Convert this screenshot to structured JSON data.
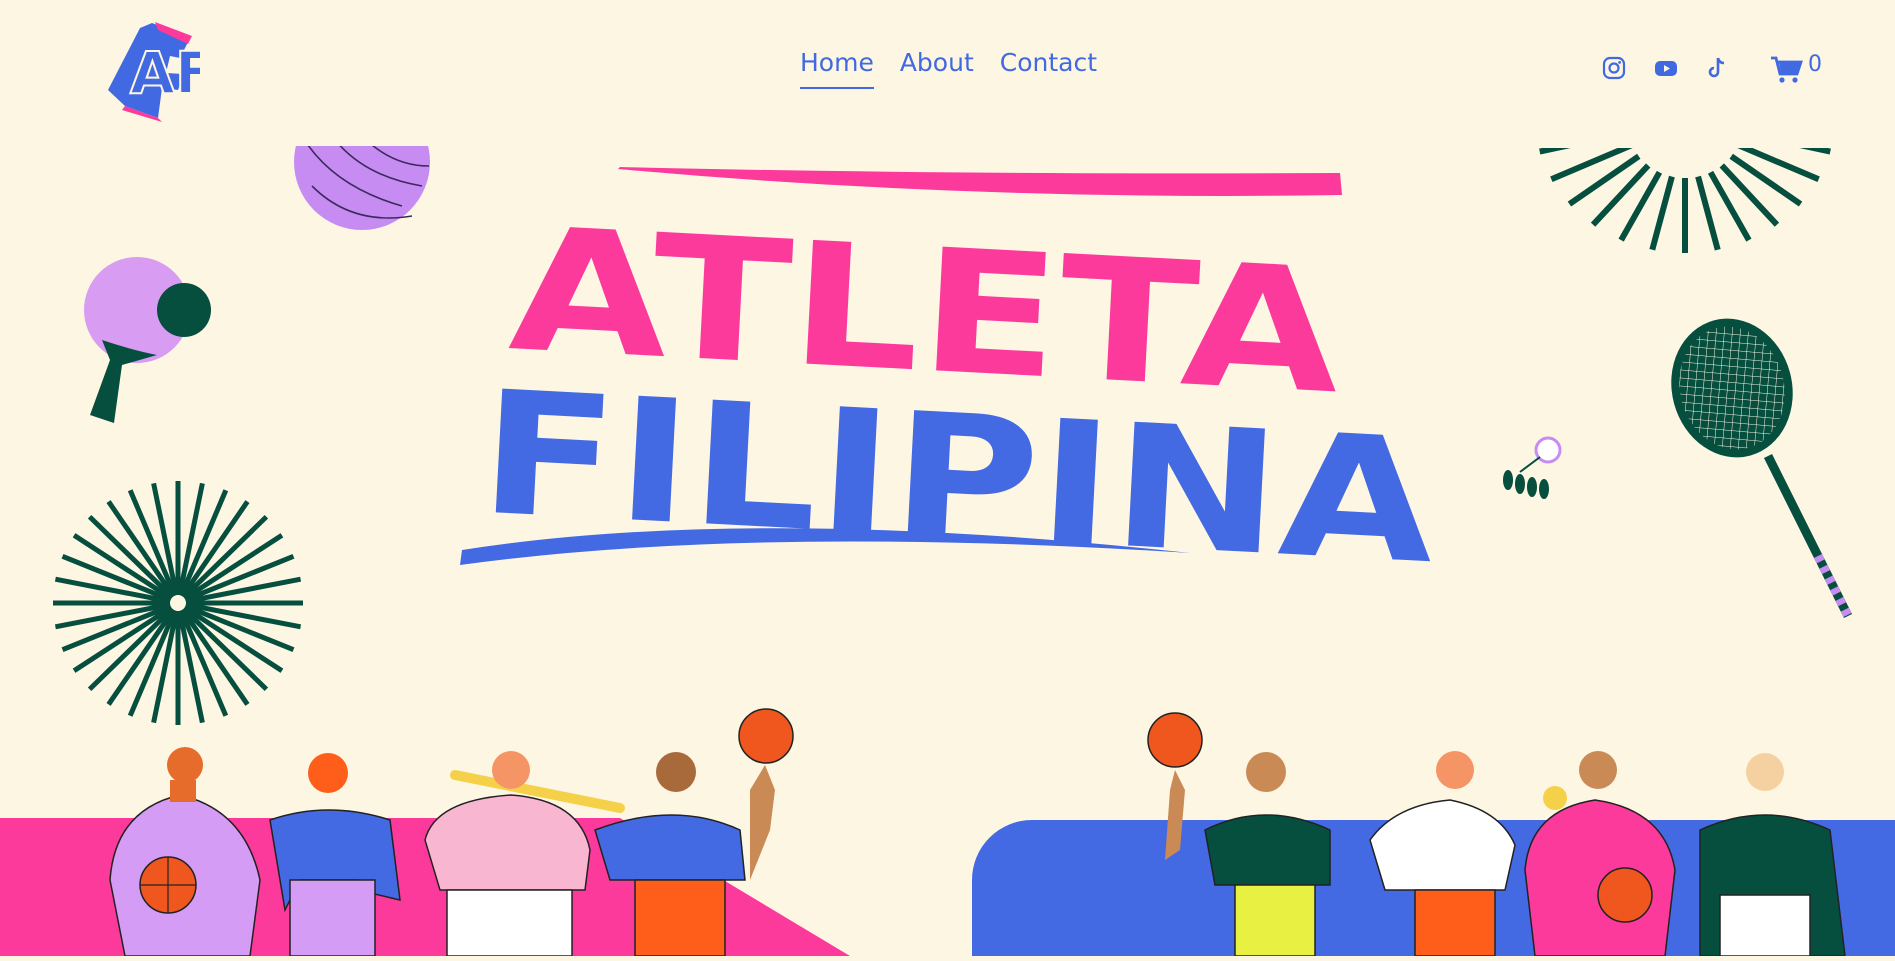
{
  "brand": {
    "logo_text": "AF",
    "colors": {
      "blue": "#4169e1",
      "pink": "#fc3a9b",
      "green": "#064f3f",
      "cream": "#fdf6e3",
      "lilac": "#d59cf5"
    }
  },
  "nav": {
    "items": [
      {
        "label": "Home",
        "active": true
      },
      {
        "label": "About",
        "active": false
      },
      {
        "label": "Contact",
        "active": false
      }
    ]
  },
  "social": {
    "icons": [
      "instagram-icon",
      "youtube-icon",
      "tiktok-icon"
    ]
  },
  "cart": {
    "icon": "cart-icon",
    "count": "0"
  },
  "hero": {
    "line1": "ATLETA",
    "line2": "FILIPINA"
  },
  "decorations": [
    "volleyball",
    "ping-pong-paddle",
    "starburst",
    "sunburst",
    "badminton-racket",
    "shuttlecock",
    "basketball",
    "baseball-bat",
    "tennis-ball"
  ]
}
